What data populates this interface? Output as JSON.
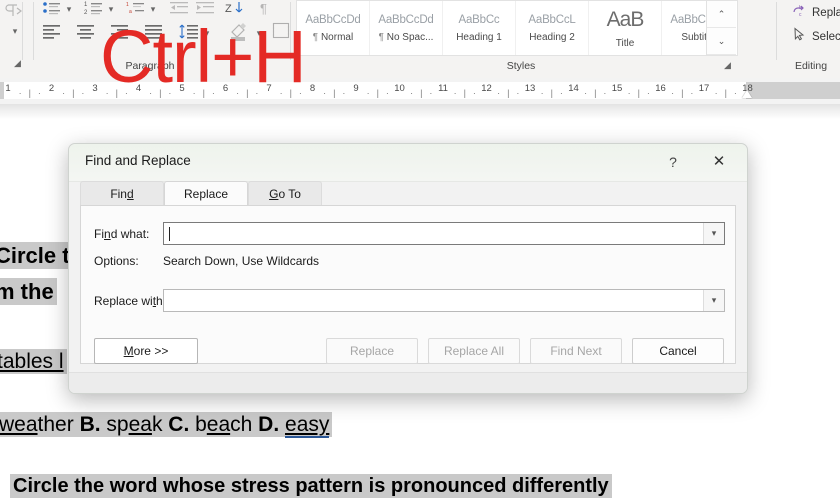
{
  "ribbon": {
    "paragraph": {
      "group_label": "Paragraph",
      "dialog_launcher": "dialog-launcher",
      "icons_row1": [
        "bullets-icon",
        "numbering-icon",
        "multilevel-list-icon",
        "decrease-indent-icon",
        "increase-indent-icon",
        "sort-icon",
        "show-formatting-marks-icon"
      ],
      "icons_row2": [
        "align-left-icon",
        "align-center-icon",
        "align-right-icon",
        "justify-icon",
        "line-spacing-icon",
        "shading-icon",
        "borders-icon"
      ]
    },
    "styles": {
      "group_label": "Styles",
      "dialog_launcher": "dialog-launcher",
      "items": [
        {
          "preview": "AaBbCcDd",
          "name": "Normal",
          "pilcrow": "¶",
          "big": false
        },
        {
          "preview": "AaBbCcDd",
          "name": "No Spac...",
          "pilcrow": "¶",
          "big": false
        },
        {
          "preview": "AaBbCc",
          "name": "Heading 1",
          "pilcrow": "",
          "big": false
        },
        {
          "preview": "AaBbCcL",
          "name": "Heading 2",
          "pilcrow": "",
          "big": false
        },
        {
          "preview": "AaB",
          "name": "Title",
          "pilcrow": "",
          "big": true
        },
        {
          "preview": "AaBbCcDd",
          "name": "Subtitle",
          "pilcrow": "",
          "big": false
        }
      ],
      "scroll_up": "⌃",
      "scroll_down": "⌄"
    },
    "editing": {
      "group_label": "Editing",
      "items": [
        {
          "label": "Replace",
          "icon": "replace-icon"
        },
        {
          "label": "Select",
          "icon": "select-pointer-icon"
        }
      ]
    }
  },
  "ruler": {
    "numbers": [
      "1",
      "2",
      "3",
      "4",
      "5",
      "6",
      "7",
      "8",
      "9",
      "10",
      "11",
      "12",
      "13",
      "14",
      "15",
      "16",
      "17",
      "18"
    ],
    "indent_marker": "hanging-indent-marker"
  },
  "overlay": {
    "shortcut_text": "Ctrl+H",
    "shortcut_color": "#e42a25"
  },
  "document": {
    "lines": [
      {
        "segments": [
          {
            "text": "Circle t",
            "bold": true,
            "hl": true
          }
        ]
      },
      {
        "segments": [
          {
            "text": "m the",
            "bold": true,
            "hl": true
          }
        ]
      },
      {
        "segments": [
          {
            "text": "tables l",
            "bold": false,
            "hl": true,
            "underline": true
          }
        ]
      },
      {
        "segments": [
          {
            "text": "wea",
            "bold": false,
            "hl": true,
            "underline": true
          },
          {
            "text": "ther ",
            "bold": false,
            "hl": true
          },
          {
            "text": "B.",
            "bold": true,
            "hl": true
          },
          {
            "text": " sp",
            "bold": false,
            "hl": true
          },
          {
            "text": "ea",
            "bold": false,
            "hl": true,
            "underline": true
          },
          {
            "text": "k ",
            "bold": false,
            "hl": true
          },
          {
            "text": "C.",
            "bold": true,
            "hl": true
          },
          {
            "text": " b",
            "bold": false,
            "hl": true
          },
          {
            "text": "ea",
            "bold": false,
            "hl": true,
            "underline": true
          },
          {
            "text": "ch ",
            "bold": false,
            "hl": true
          },
          {
            "text": "D.",
            "bold": true,
            "hl": true
          },
          {
            "text": " ",
            "bold": false,
            "hl": true
          },
          {
            "text": "easy",
            "bold": false,
            "hl": true,
            "underline": true,
            "wavy": true
          }
        ]
      },
      {
        "segments": [
          {
            "text": "Circle the word whose stress pattern is pronounced differently",
            "bold": true,
            "hl": true
          }
        ]
      }
    ]
  },
  "dialog": {
    "title": "Find and Replace",
    "help_icon": "?",
    "close_icon": "✕",
    "tabs": [
      {
        "label": "Find",
        "accel_index": 3,
        "active": false
      },
      {
        "label": "Replace",
        "accel_index": -1,
        "active": true
      },
      {
        "label": "Go To",
        "accel_index": 0,
        "active": false
      }
    ],
    "fields": {
      "find_label": "Find what:",
      "find_accel_index": 2,
      "find_value": "",
      "find_placeholder": "",
      "options_label": "Options:",
      "options_value": "Search Down, Use Wildcards",
      "replace_label": "Replace with:",
      "replace_accel_index": 10,
      "replace_value": "",
      "replace_placeholder": "",
      "dropdown_icon": "chevron-down-icon"
    },
    "buttons": [
      {
        "label": "More >>",
        "accel_index": 0,
        "disabled": false,
        "kind": "more"
      },
      {
        "label": "Replace",
        "accel_index": -1,
        "disabled": true,
        "kind": "action"
      },
      {
        "label": "Replace All",
        "accel_index": -1,
        "disabled": true,
        "kind": "action"
      },
      {
        "label": "Find Next",
        "accel_index": -1,
        "disabled": true,
        "kind": "action"
      },
      {
        "label": "Cancel",
        "accel_index": -1,
        "disabled": false,
        "kind": "action"
      }
    ]
  }
}
